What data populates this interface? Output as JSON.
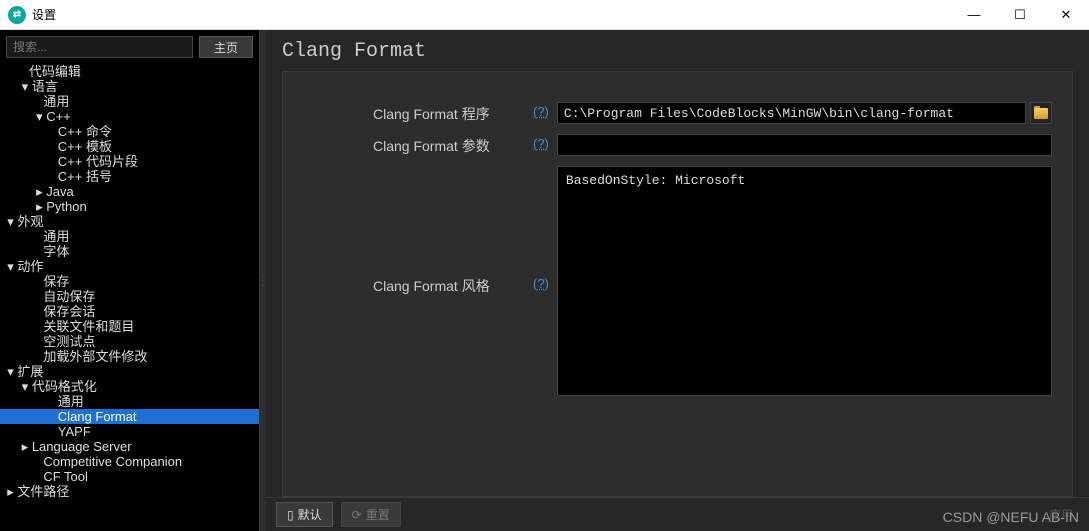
{
  "window": {
    "title": "设置",
    "minimize": "—",
    "maximize": "☐",
    "close": "✕"
  },
  "sidebar": {
    "search_placeholder": "搜索...",
    "home_button": "主页"
  },
  "tree": [
    {
      "indent": 1,
      "arrow": "",
      "label": "代码编辑",
      "sel": false
    },
    {
      "indent": 1,
      "arrow": "▾",
      "label": "语言",
      "sel": false
    },
    {
      "indent": 2,
      "arrow": "",
      "label": "通用",
      "sel": false
    },
    {
      "indent": 2,
      "arrow": "▾",
      "label": "C++",
      "sel": false
    },
    {
      "indent": 3,
      "arrow": "",
      "label": "C++ 命令",
      "sel": false
    },
    {
      "indent": 3,
      "arrow": "",
      "label": "C++ 模板",
      "sel": false
    },
    {
      "indent": 3,
      "arrow": "",
      "label": "C++ 代码片段",
      "sel": false
    },
    {
      "indent": 3,
      "arrow": "",
      "label": "C++ 括号",
      "sel": false
    },
    {
      "indent": 2,
      "arrow": "▸",
      "label": "Java",
      "sel": false
    },
    {
      "indent": 2,
      "arrow": "▸",
      "label": "Python",
      "sel": false
    },
    {
      "indent": 0,
      "arrow": "▾",
      "label": "外观",
      "sel": false
    },
    {
      "indent": 2,
      "arrow": "",
      "label": "通用",
      "sel": false
    },
    {
      "indent": 2,
      "arrow": "",
      "label": "字体",
      "sel": false
    },
    {
      "indent": 0,
      "arrow": "▾",
      "label": "动作",
      "sel": false
    },
    {
      "indent": 2,
      "arrow": "",
      "label": "保存",
      "sel": false
    },
    {
      "indent": 2,
      "arrow": "",
      "label": "自动保存",
      "sel": false
    },
    {
      "indent": 2,
      "arrow": "",
      "label": "保存会话",
      "sel": false
    },
    {
      "indent": 2,
      "arrow": "",
      "label": "关联文件和题目",
      "sel": false
    },
    {
      "indent": 2,
      "arrow": "",
      "label": "空测试点",
      "sel": false
    },
    {
      "indent": 2,
      "arrow": "",
      "label": "加载外部文件修改",
      "sel": false
    },
    {
      "indent": 0,
      "arrow": "▾",
      "label": "扩展",
      "sel": false
    },
    {
      "indent": 1,
      "arrow": "▾",
      "label": "代码格式化",
      "sel": false
    },
    {
      "indent": 3,
      "arrow": "",
      "label": "通用",
      "sel": false
    },
    {
      "indent": 3,
      "arrow": "",
      "label": "Clang Format",
      "sel": true
    },
    {
      "indent": 3,
      "arrow": "",
      "label": "YAPF",
      "sel": false
    },
    {
      "indent": 1,
      "arrow": "▸",
      "label": "Language Server",
      "sel": false
    },
    {
      "indent": 2,
      "arrow": "",
      "label": "Competitive Companion",
      "sel": false
    },
    {
      "indent": 2,
      "arrow": "",
      "label": "CF Tool",
      "sel": false
    },
    {
      "indent": 0,
      "arrow": "▸",
      "label": "文件路径",
      "sel": false
    }
  ],
  "content": {
    "heading": "Clang Format",
    "help_text": "(?)",
    "row_program_label": "Clang Format 程序",
    "row_program_value": "C:\\Program Files\\CodeBlocks\\MinGW\\bin\\clang-format",
    "row_args_label": "Clang Format 参数",
    "row_args_value": "",
    "row_style_label": "Clang Format 风格",
    "row_style_value": "BasedOnStyle: Microsoft"
  },
  "bottom": {
    "default": "默认",
    "reset": "重置",
    "apply": "应用"
  },
  "watermark": "CSDN @NEFU AB-IN"
}
